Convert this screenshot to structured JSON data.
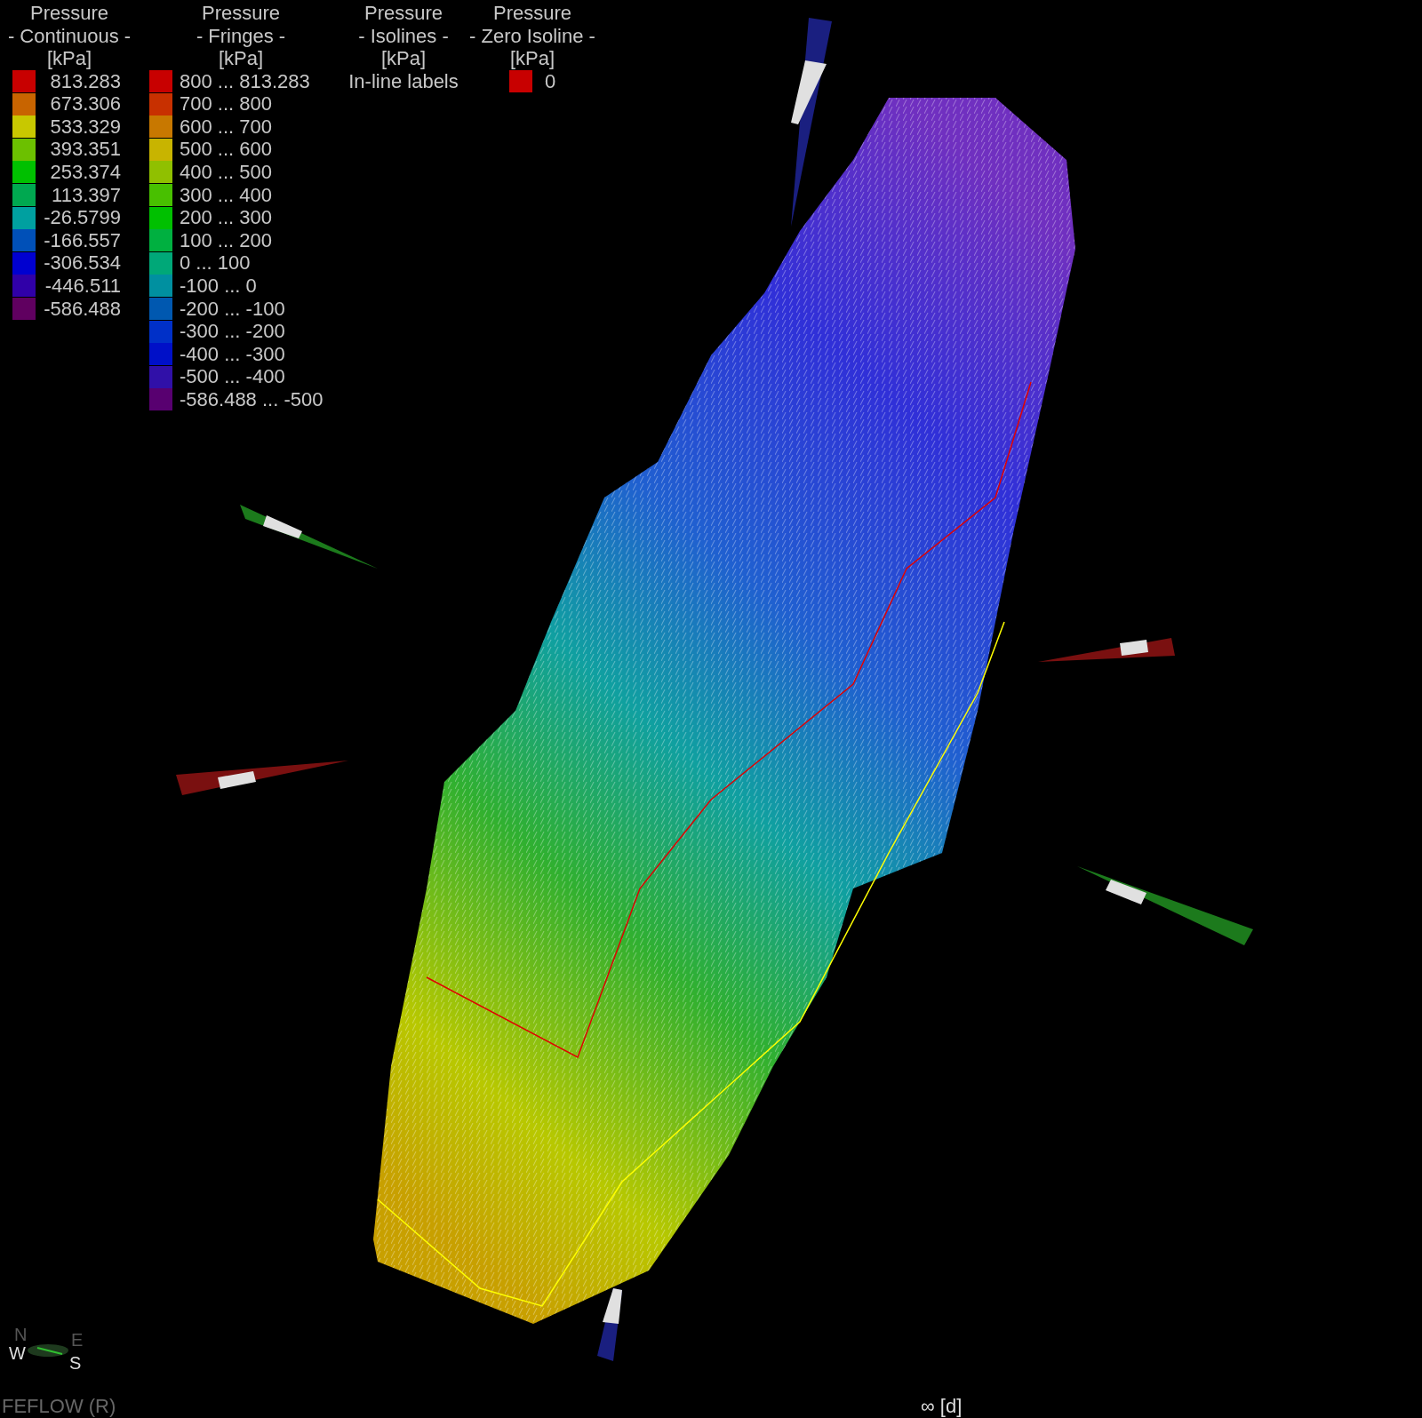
{
  "legends": [
    {
      "title": "Pressure",
      "subtitle": "- Continuous -",
      "unit": "[kPa]",
      "items": [
        {
          "label": "813.283",
          "color": "#c80000"
        },
        {
          "label": "673.306",
          "color": "#c86400"
        },
        {
          "label": "533.329",
          "color": "#c8c800"
        },
        {
          "label": "393.351",
          "color": "#6cc000"
        },
        {
          "label": "253.374",
          "color": "#00c000"
        },
        {
          "label": "113.397",
          "color": "#00a850"
        },
        {
          "label": "-26.5799",
          "color": "#00a0a0"
        },
        {
          "label": "-166.557",
          "color": "#0050b8"
        },
        {
          "label": "-306.534",
          "color": "#0000d0"
        },
        {
          "label": "-446.511",
          "color": "#3000a8"
        },
        {
          "label": "-586.488",
          "color": "#600060"
        }
      ]
    },
    {
      "title": "Pressure",
      "subtitle": "- Fringes -",
      "unit": "[kPa]",
      "items": [
        {
          "label": "800 ...  813.283",
          "color": "#c80000"
        },
        {
          "label": "700 ...  800",
          "color": "#c83000"
        },
        {
          "label": "600 ...  700",
          "color": "#c87800"
        },
        {
          "label": "500 ...  600",
          "color": "#c8b400"
        },
        {
          "label": "400 ...  500",
          "color": "#90c000"
        },
        {
          "label": "300 ...  400",
          "color": "#48c000"
        },
        {
          "label": "200 ...  300",
          "color": "#00c000"
        },
        {
          "label": "100 ...  200",
          "color": "#00b040"
        },
        {
          "label": "0 ...  100",
          "color": "#00a878"
        },
        {
          "label": "-100 ...  0",
          "color": "#0090a0"
        },
        {
          "label": "-200 ... -100",
          "color": "#0058b0"
        },
        {
          "label": "-300 ... -200",
          "color": "#0030c8"
        },
        {
          "label": "-400 ... -300",
          "color": "#0010c8"
        },
        {
          "label": "-500 ... -400",
          "color": "#3010a8"
        },
        {
          "label": "-586.488 ... -500",
          "color": "#580070"
        }
      ]
    },
    {
      "title": "Pressure",
      "subtitle": "- Isolines -",
      "unit": "[kPa]",
      "note": "In-line labels"
    },
    {
      "title": "Pressure",
      "subtitle": "- Zero Isoline -",
      "unit": "[kPa]",
      "items": [
        {
          "label": "0",
          "color": "#c80000"
        }
      ]
    }
  ],
  "compass": {
    "north": "N",
    "east": "E",
    "west": "W",
    "south": "S"
  },
  "footer": {
    "product": "FEFLOW (R)",
    "time": "∞ [d]"
  }
}
